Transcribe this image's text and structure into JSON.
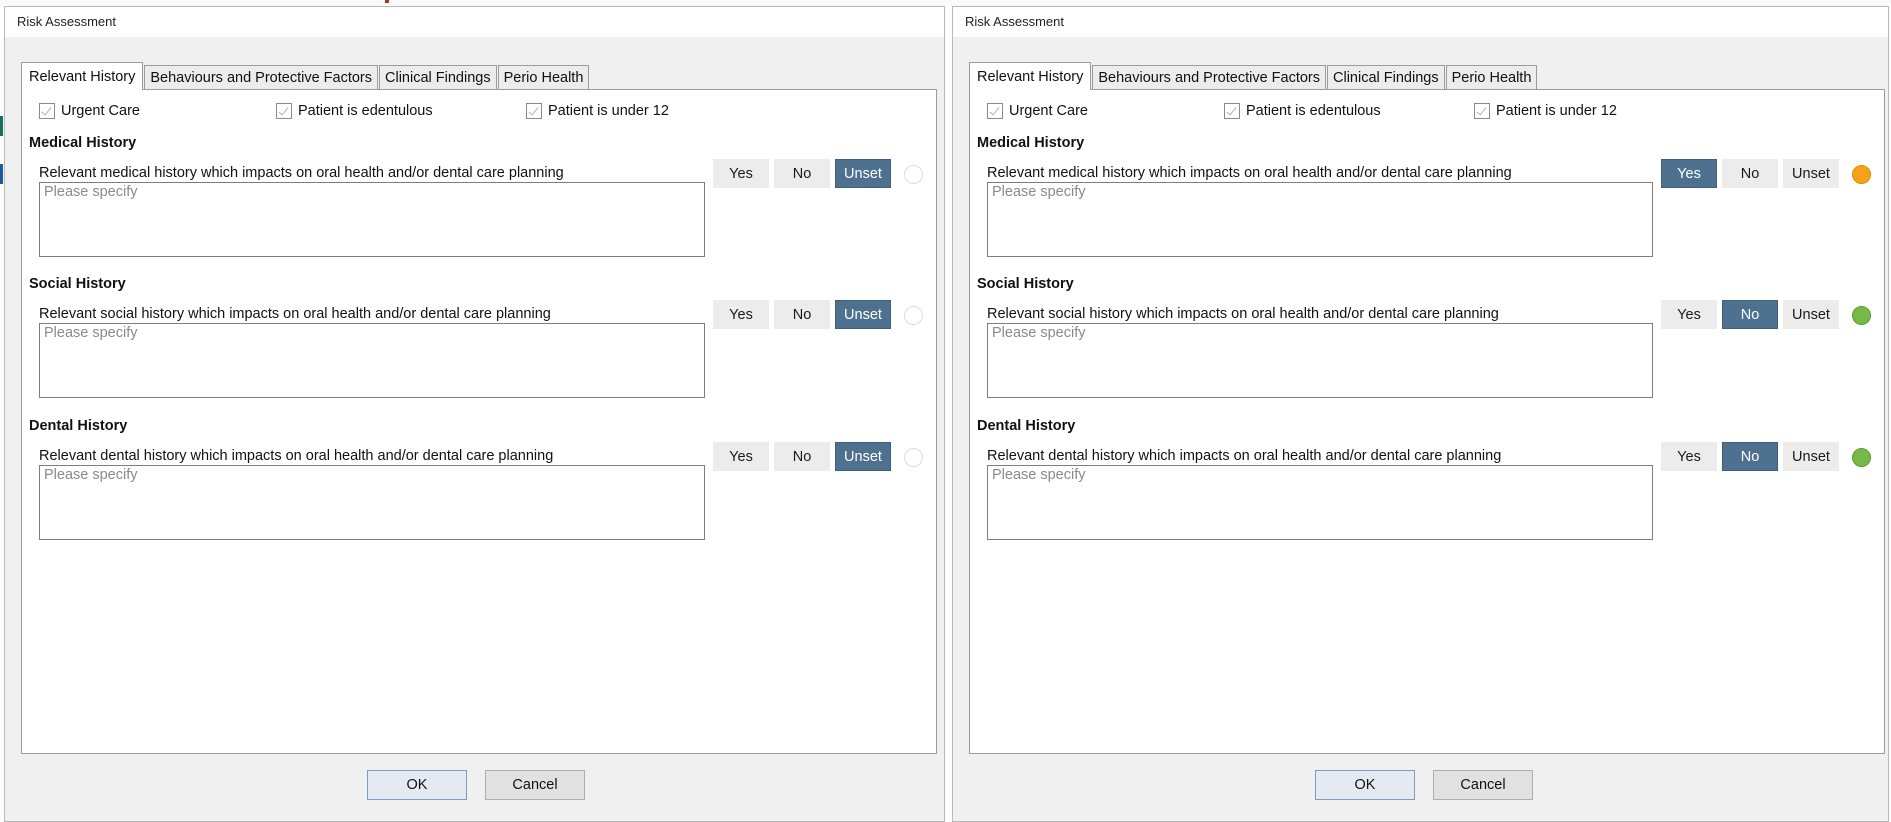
{
  "dialogs": [
    {
      "title": "Risk Assessment",
      "tabs": [
        {
          "label": "Relevant History",
          "active": true
        },
        {
          "label": "Behaviours and Protective Factors",
          "active": false
        },
        {
          "label": "Clinical Findings",
          "active": false
        },
        {
          "label": "Perio Health",
          "active": false
        }
      ],
      "checkboxes": [
        {
          "label": "Urgent Care",
          "checked": false
        },
        {
          "label": "Patient is edentulous",
          "checked": false
        },
        {
          "label": "Patient is under 12",
          "checked": false
        }
      ],
      "sections": [
        {
          "title": "Medical History",
          "description": "Relevant medical history which impacts on oral health and/or dental care planning",
          "placeholder": "Please specify",
          "options": [
            "Yes",
            "No",
            "Unset"
          ],
          "selected": "Unset",
          "indicator": "none"
        },
        {
          "title": "Social History",
          "description": "Relevant social history which impacts on oral health and/or dental care planning",
          "placeholder": "Please specify",
          "options": [
            "Yes",
            "No",
            "Unset"
          ],
          "selected": "Unset",
          "indicator": "none"
        },
        {
          "title": "Dental History",
          "description": "Relevant dental history which impacts on oral health and/or dental care planning",
          "placeholder": "Please specify",
          "options": [
            "Yes",
            "No",
            "Unset"
          ],
          "selected": "Unset",
          "indicator": "none"
        }
      ],
      "ok_label": "OK",
      "cancel_label": "Cancel"
    },
    {
      "title": "Risk Assessment",
      "tabs": [
        {
          "label": "Relevant History",
          "active": true
        },
        {
          "label": "Behaviours and Protective Factors",
          "active": false
        },
        {
          "label": "Clinical Findings",
          "active": false
        },
        {
          "label": "Perio Health",
          "active": false
        }
      ],
      "checkboxes": [
        {
          "label": "Urgent Care",
          "checked": false
        },
        {
          "label": "Patient is edentulous",
          "checked": false
        },
        {
          "label": "Patient is under 12",
          "checked": false
        }
      ],
      "sections": [
        {
          "title": "Medical History",
          "description": "Relevant medical history which impacts on oral health and/or dental care planning",
          "placeholder": "Please specify",
          "options": [
            "Yes",
            "No",
            "Unset"
          ],
          "selected": "Yes",
          "indicator": "orange"
        },
        {
          "title": "Social History",
          "description": "Relevant social history which impacts on oral health and/or dental care planning",
          "placeholder": "Please specify",
          "options": [
            "Yes",
            "No",
            "Unset"
          ],
          "selected": "No",
          "indicator": "green"
        },
        {
          "title": "Dental History",
          "description": "Relevant dental history which impacts on oral health and/or dental care planning",
          "placeholder": "Please specify",
          "options": [
            "Yes",
            "No",
            "Unset"
          ],
          "selected": "No",
          "indicator": "green"
        }
      ],
      "ok_label": "OK",
      "cancel_label": "Cancel"
    }
  ],
  "colors": {
    "selected_button": "#4f7190",
    "indicator_orange": "#f5a21b",
    "indicator_green": "#76b947"
  }
}
